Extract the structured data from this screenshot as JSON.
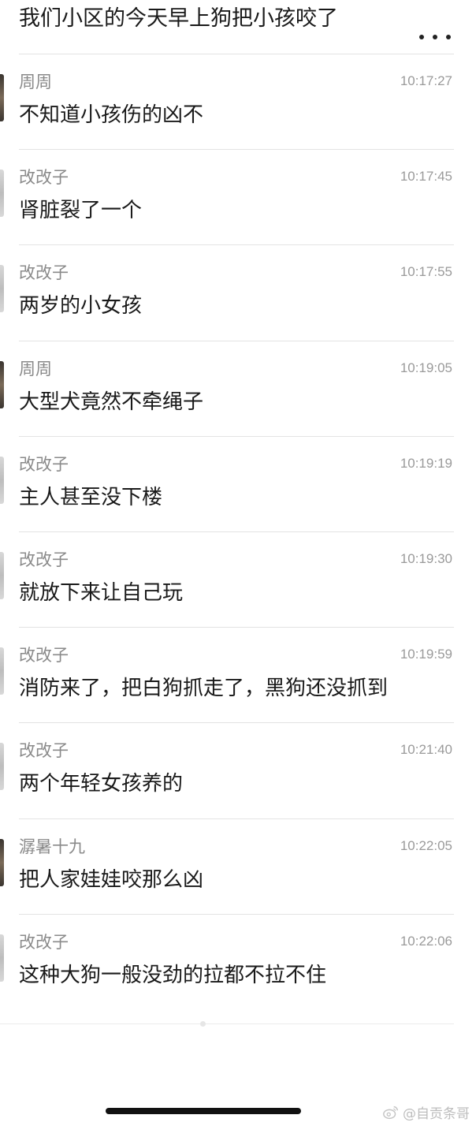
{
  "header": {
    "title": "我们小区的今天早上狗把小孩咬了"
  },
  "messages": [
    {
      "sender": "周周",
      "time": "10:17:27",
      "text": "不知道小孩伤的凶不",
      "avatar": "dark"
    },
    {
      "sender": "改改子",
      "time": "10:17:45",
      "text": "肾脏裂了一个",
      "avatar": "light"
    },
    {
      "sender": "改改子",
      "time": "10:17:55",
      "text": "两岁的小女孩",
      "avatar": "light"
    },
    {
      "sender": "周周",
      "time": "10:19:05",
      "text": "大型犬竟然不牵绳子",
      "avatar": "dark"
    },
    {
      "sender": "改改子",
      "time": "10:19:19",
      "text": "主人甚至没下楼",
      "avatar": "light"
    },
    {
      "sender": "改改子",
      "time": "10:19:30",
      "text": "就放下来让自己玩",
      "avatar": "light"
    },
    {
      "sender": "改改子",
      "time": "10:19:59",
      "text": "消防来了，把白狗抓走了，黑狗还没抓到",
      "avatar": "light"
    },
    {
      "sender": "改改子",
      "time": "10:21:40",
      "text": "两个年轻女孩养的",
      "avatar": "light"
    },
    {
      "sender": "潺暑十九",
      "time": "10:22:05",
      "text": "把人家娃娃咬那么凶",
      "avatar": "dark"
    },
    {
      "sender": "改改子",
      "time": "10:22:06",
      "text": "这种大狗一般没劲的拉都不拉不住",
      "avatar": "light"
    }
  ],
  "watermark": {
    "text": "@自贡条哥",
    "icon": "weibo-icon"
  }
}
